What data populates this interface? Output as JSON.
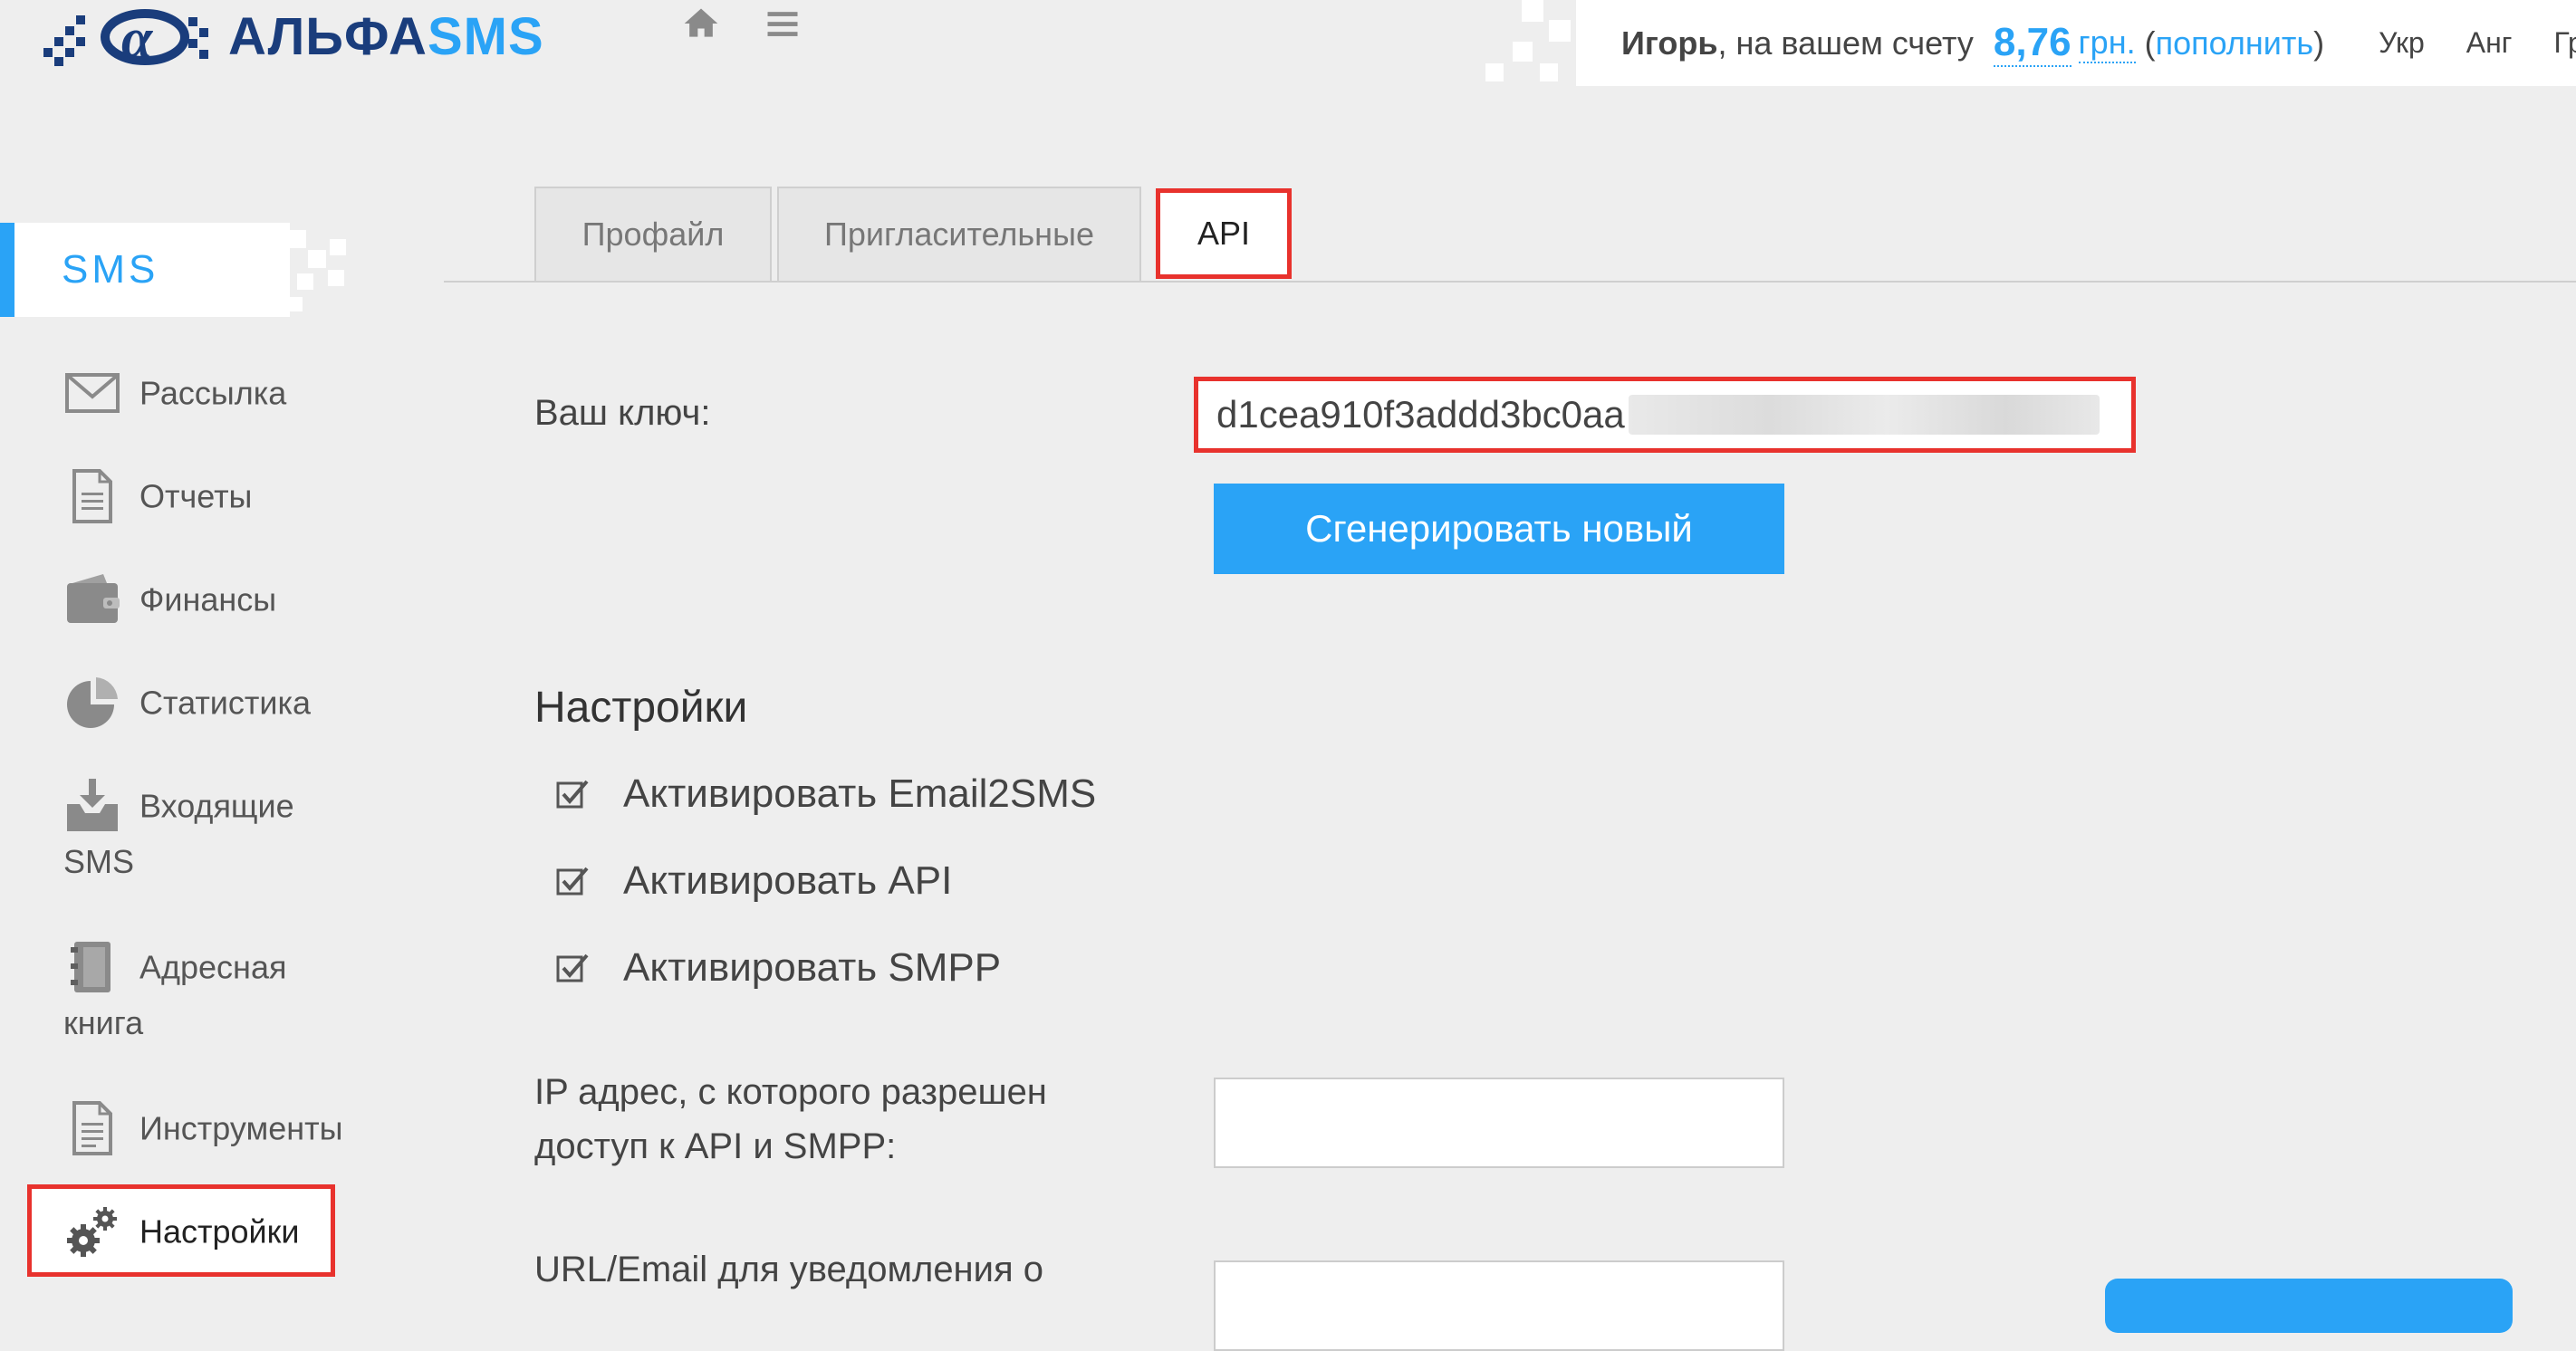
{
  "header": {
    "logo_prefix": "АЛЬФА",
    "logo_accent": "SMS",
    "home_icon": "home-icon",
    "menu_icon": "menu-icon",
    "user": {
      "name": "Игорь",
      "account_text": ", на вашем счету ",
      "balance": "8,76",
      "currency": "грн.",
      "topup_open": " (",
      "topup_label": "пополнить",
      "topup_close": ")"
    },
    "languages": [
      "Укр",
      "Анг",
      "Гру"
    ]
  },
  "sidebar": {
    "title": "SMS",
    "items": [
      {
        "label": "Рассылка",
        "icon": "envelope-icon"
      },
      {
        "label": "Отчеты",
        "icon": "document-icon"
      },
      {
        "label": "Финансы",
        "icon": "wallet-icon"
      },
      {
        "label": "Статистика",
        "icon": "pie-chart-icon"
      },
      {
        "label": "Входящие",
        "label2": "SMS",
        "icon": "inbox-download-icon"
      },
      {
        "label": "Адресная",
        "label2": "книга",
        "icon": "address-book-icon"
      },
      {
        "label": "Инструменты",
        "icon": "tools-document-icon"
      },
      {
        "label": "Настройки",
        "icon": "gears-icon"
      }
    ]
  },
  "tabs": [
    {
      "label": "Профайл"
    },
    {
      "label": "Пригласительные"
    },
    {
      "label": "API",
      "active": true
    }
  ],
  "api": {
    "key_label": "Ваш ключ:",
    "key_value": "d1cea910f3addd3bc0aa",
    "generate_label": "Сгенерировать новый"
  },
  "settings": {
    "title": "Настройки",
    "options": [
      {
        "label": "Активировать Email2SMS",
        "checked": true
      },
      {
        "label": "Активировать API",
        "checked": true
      },
      {
        "label": "Активировать SMPP",
        "checked": true
      }
    ],
    "ip_label_line1": "IP адрес, с которого разрешен",
    "ip_label_line2": "доступ к API и SMPP:",
    "ip_value": "",
    "url_label": "URL/Email для уведомления о",
    "url_value": ""
  },
  "colors": {
    "accent": "#2aa3f6",
    "brand_dark": "#1a3d7c",
    "highlight": "#e8322d",
    "background": "#eeeeee"
  }
}
